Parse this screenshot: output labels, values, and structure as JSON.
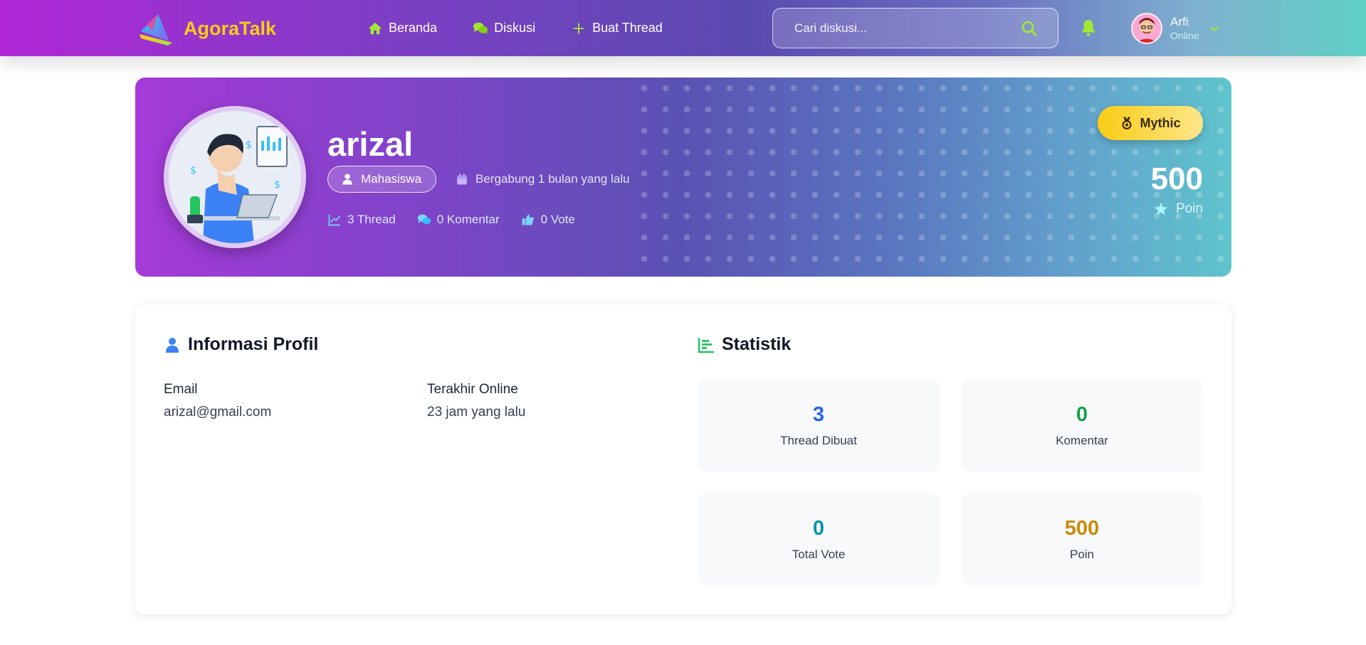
{
  "nav": {
    "brand": "AgoraTalk",
    "links": [
      {
        "label": "Beranda",
        "icon": "home-icon"
      },
      {
        "label": "Diskusi",
        "icon": "comments-icon"
      },
      {
        "label": "Buat Thread",
        "icon": "plus-icon"
      }
    ],
    "search_placeholder": "Cari diskusi...",
    "user": {
      "name": "Arfi",
      "status": "Online"
    }
  },
  "profile": {
    "username": "arizal",
    "role": "Mahasiswa",
    "joined": "Bergabung 1 bulan yang lalu",
    "stats": {
      "threads": "3 Thread",
      "comments": "0 Komentar",
      "votes": "0 Vote"
    },
    "rank": "Mythic",
    "points": "500",
    "points_label": "Poin"
  },
  "info": {
    "title": "Informasi Profil",
    "email_label": "Email",
    "email": "arizal@gmail.com",
    "last_online_label": "Terakhir Online",
    "last_online": "23 jam yang lalu"
  },
  "statistics": {
    "title": "Statistik",
    "items": [
      {
        "value": "3",
        "label": "Thread Dibuat",
        "color": "#2563eb"
      },
      {
        "value": "0",
        "label": "Komentar",
        "color": "#16a34a"
      },
      {
        "value": "0",
        "label": "Total Vote",
        "color": "#0891b2"
      },
      {
        "value": "500",
        "label": "Poin",
        "color": "#ca8a04"
      }
    ]
  },
  "colors": {
    "accent_yellow": "#facc15",
    "icon_green": "#a3e635"
  }
}
